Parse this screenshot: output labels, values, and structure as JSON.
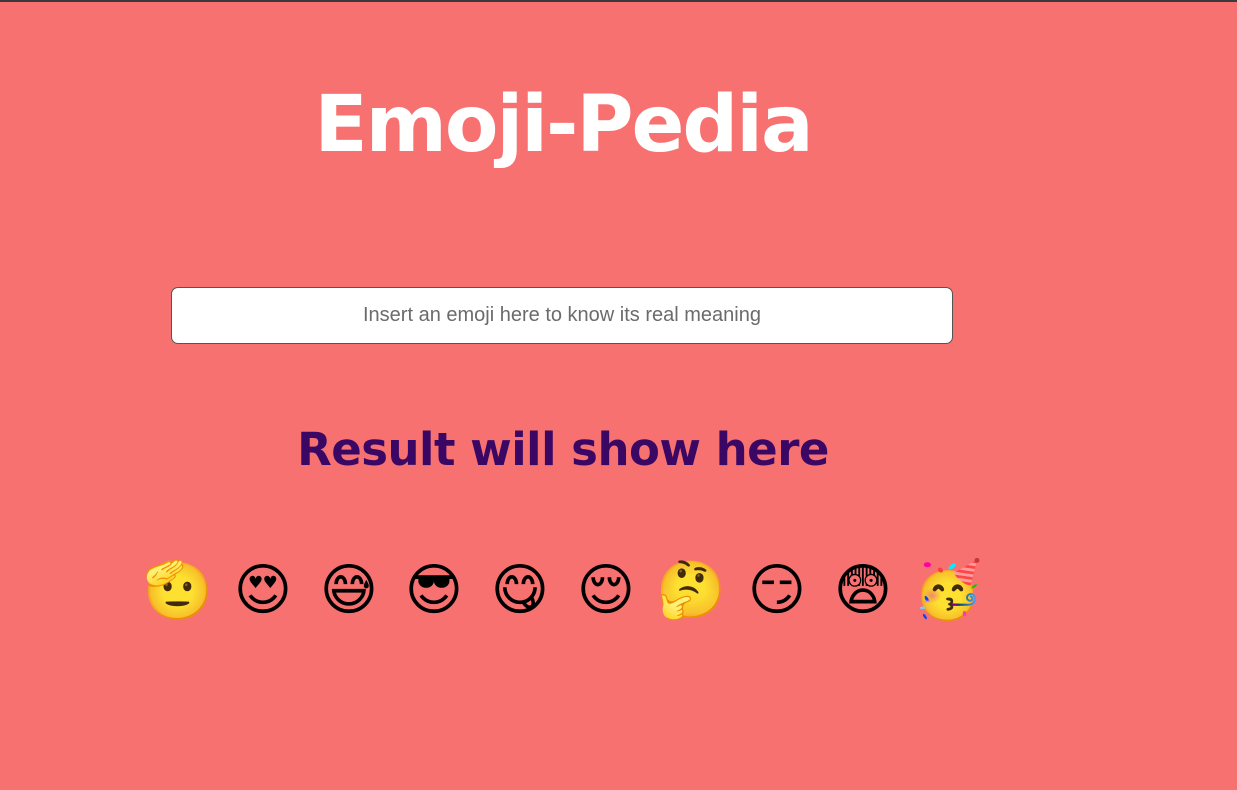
{
  "header": {
    "title": "Emoji-Pedia"
  },
  "search": {
    "placeholder": "Insert an emoji here to know its real meaning",
    "value": ""
  },
  "result": {
    "text": "Result will show here"
  },
  "emojis": [
    {
      "char": "🫡"
    },
    {
      "char": "😍"
    },
    {
      "char": "😅"
    },
    {
      "char": "😎"
    },
    {
      "char": "😋"
    },
    {
      "char": "😌"
    },
    {
      "char": "🤔"
    },
    {
      "char": "😏"
    },
    {
      "char": "😨"
    },
    {
      "char": "🥳"
    }
  ],
  "colors": {
    "background": "#f87171",
    "title": "#ffffff",
    "result": "#3b0764"
  }
}
